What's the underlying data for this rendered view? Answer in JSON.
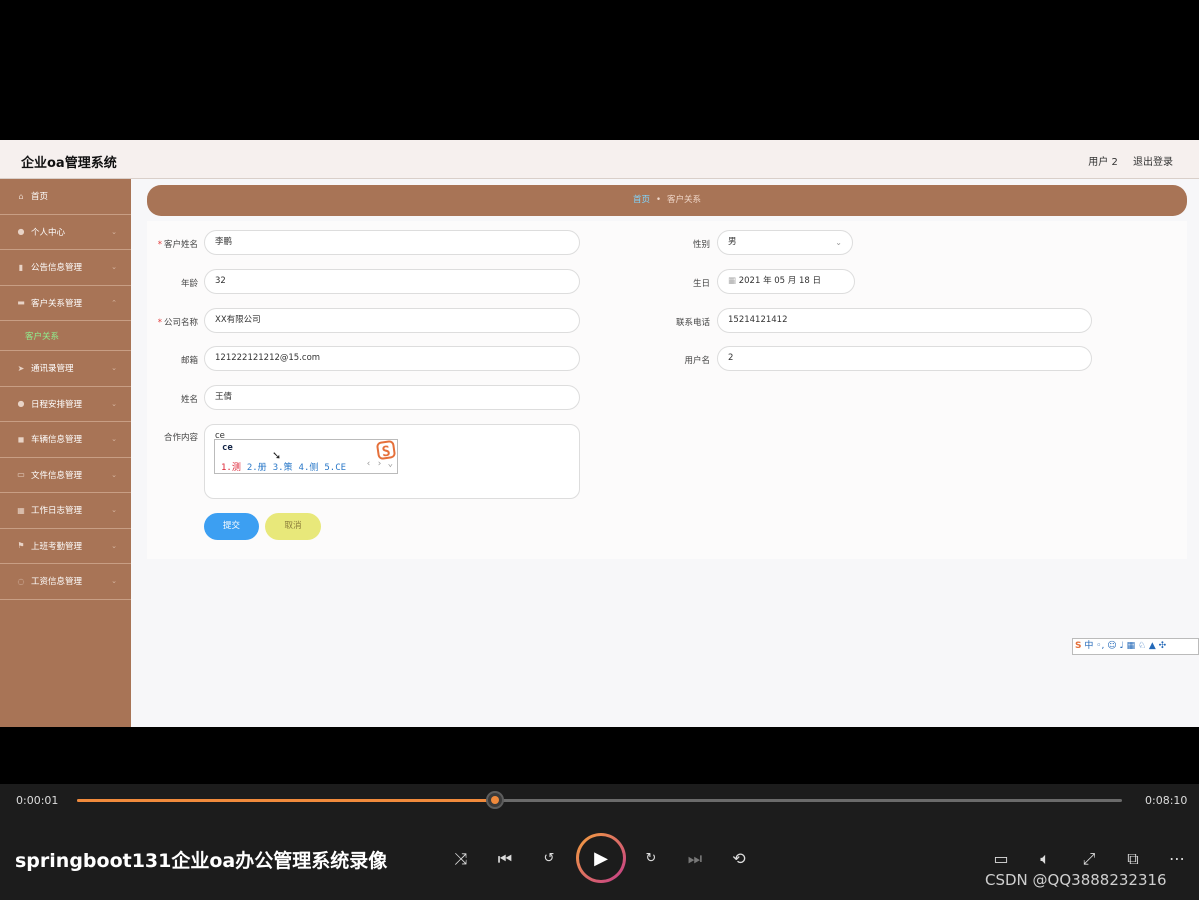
{
  "app": {
    "brand": "企业oa管理系统",
    "user_label": "用户 2",
    "logout_label": "退出登录"
  },
  "sidebar": {
    "items": [
      {
        "label": "首页",
        "icon": "home-icon"
      },
      {
        "label": "个人中心",
        "icon": "person-icon"
      },
      {
        "label": "公告信息管理",
        "icon": "bar-chart-icon"
      },
      {
        "label": "客户关系管理",
        "icon": "monitor-icon"
      },
      {
        "label": "通讯录管理",
        "icon": "send-icon"
      },
      {
        "label": "日程安排管理",
        "icon": "person-icon"
      },
      {
        "label": "车辆信息管理",
        "icon": "car-icon"
      },
      {
        "label": "文件信息管理",
        "icon": "card-icon"
      },
      {
        "label": "工作日志管理",
        "icon": "grid-icon"
      },
      {
        "label": "上班考勤管理",
        "icon": "flag-icon"
      },
      {
        "label": "工资信息管理",
        "icon": "power-icon"
      }
    ],
    "sub_item": "客户关系"
  },
  "breadcrumb": {
    "home": "首页",
    "separator": "•",
    "current": "客户关系"
  },
  "form": {
    "customer_name_label": "客户姓名",
    "customer_name": "李鹏",
    "gender_label": "性别",
    "gender": "男",
    "age_label": "年龄",
    "age": "32",
    "birthday_label": "生日",
    "birthday": "2021 年 05 月 18 日",
    "company_label": "公司名称",
    "company": "XX有限公司",
    "phone_label": "联系电话",
    "phone": "15214121412",
    "email_label": "邮箱",
    "email": "121222121212@15.com",
    "username_label": "用户名",
    "username": "2",
    "name_label": "姓名",
    "name": "王倩",
    "coop_label": "合作内容",
    "coop": "ce",
    "submit_label": "提交",
    "cancel_label": "取消"
  },
  "ime": {
    "typed": "ce",
    "candidates": [
      "1.测",
      "2.册",
      "3.策",
      "4.侧",
      "5.CE"
    ],
    "pager": "‹ › ⌄",
    "logo": "S",
    "toolbar": "中 ◦, ☺ ♩ ▦ ♘ ▲ ✣"
  },
  "player": {
    "current_time": "0:00:01",
    "total_time": "0:08:10",
    "progress": 0.4,
    "title": "springboot131企业oa办公管理系统录像",
    "watermark": "CSDN @QQ3888232316"
  }
}
